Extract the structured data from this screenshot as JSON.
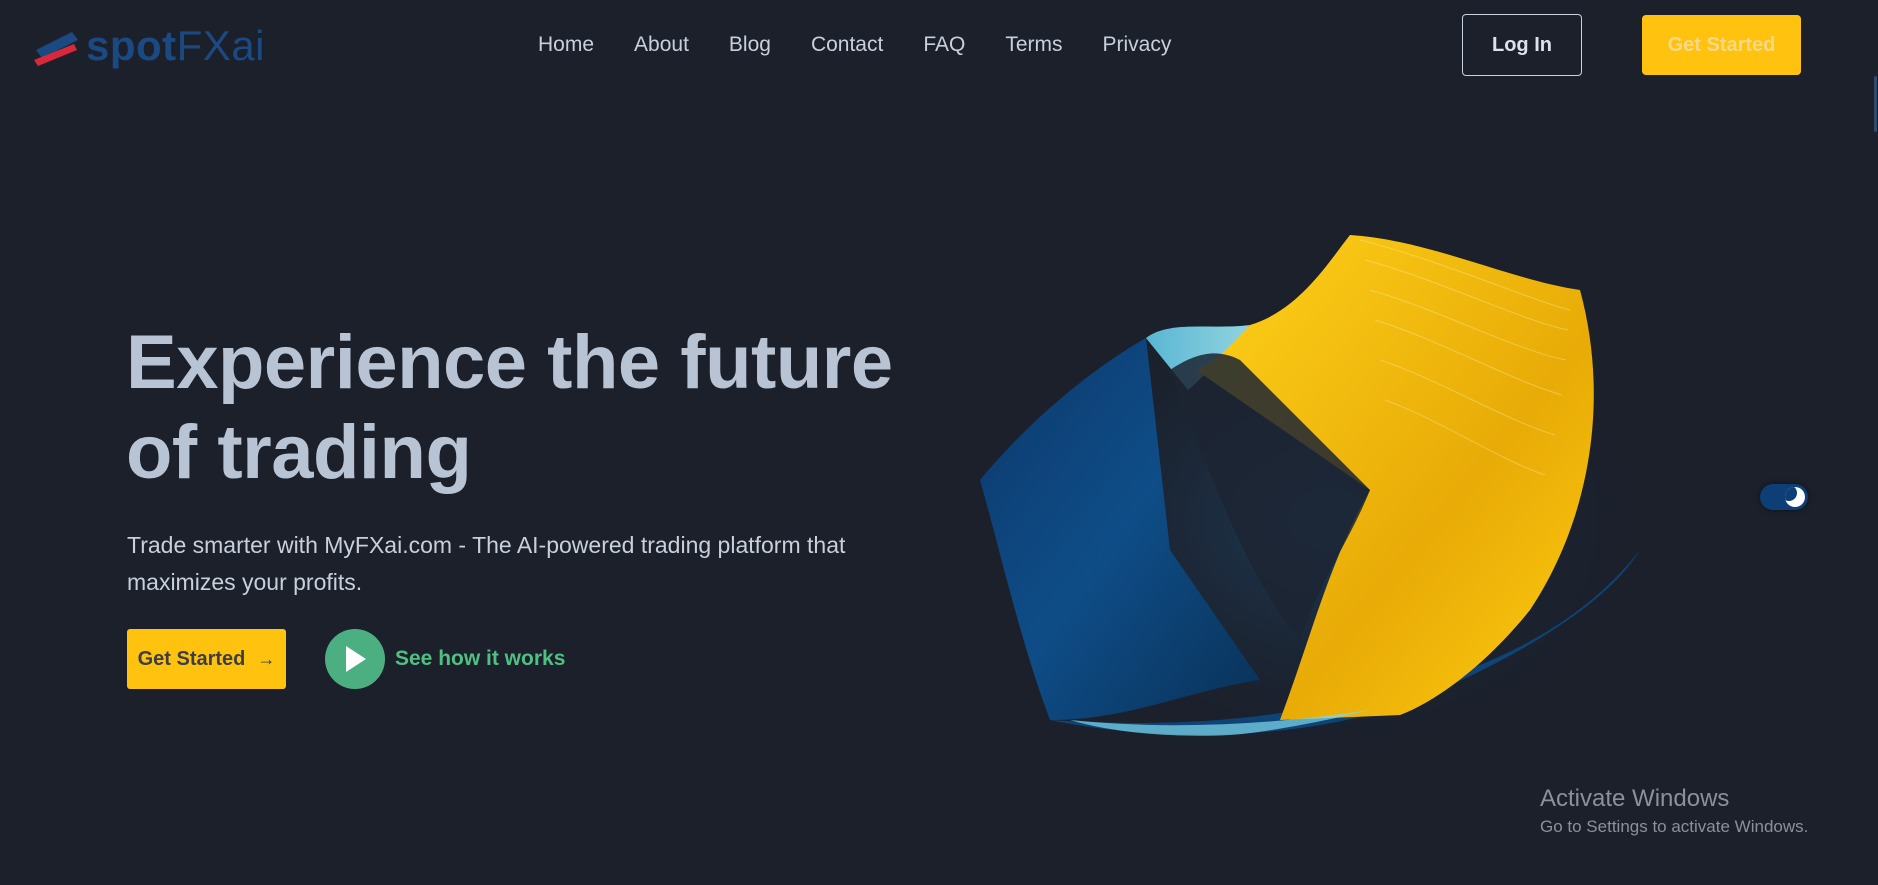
{
  "header": {
    "logo": {
      "part1": "spot",
      "part2": "FXai"
    },
    "nav": [
      "Home",
      "About",
      "Blog",
      "Contact",
      "FAQ",
      "Terms",
      "Privacy"
    ],
    "login_label": "Log In",
    "get_started_label": "Get Started"
  },
  "hero": {
    "title": "Experience the future of trading",
    "subtitle": "Trade smarter with MyFXai.com - The AI-powered trading platform that maximizes your profits.",
    "cta_label": "Get Started",
    "cta_arrow": "→",
    "play_label": "See how it works"
  },
  "theme_toggle": {
    "mode": "dark"
  },
  "watermark": {
    "line1": "Activate Windows",
    "line2": "Go to Settings to activate Windows."
  },
  "colors": {
    "background": "#1b202b",
    "accent_yellow": "#ffc20e",
    "accent_green": "#4caf82",
    "brand_blue": "#1b4a82",
    "logo_red": "#d8283c"
  },
  "icons": {
    "logo_mark": "logo-stripes-icon",
    "play": "play-icon",
    "arrow": "arrow-right-icon",
    "theme": "moon-icon"
  }
}
